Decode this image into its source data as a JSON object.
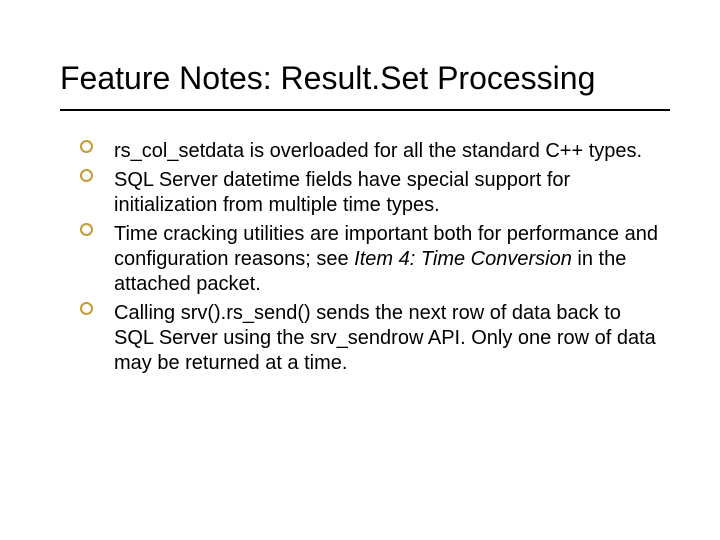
{
  "slide": {
    "title": "Feature Notes: Result.Set Processing",
    "bullets": [
      {
        "text_parts": [
          {
            "text": "rs_col_setdata is overloaded for all the standard C++ types.",
            "italic": false
          }
        ]
      },
      {
        "text_parts": [
          {
            "text": "SQL Server datetime fields have special support for initialization from multiple time types.",
            "italic": false
          }
        ]
      },
      {
        "text_parts": [
          {
            "text": "Time cracking utilities are important both for performance and configuration reasons; see ",
            "italic": false
          },
          {
            "text": "Item 4: Time Conversion",
            "italic": true
          },
          {
            "text": " in the attached packet.",
            "italic": false
          }
        ]
      },
      {
        "text_parts": [
          {
            "text": "Calling srv().rs_send() sends the next row of data back to SQL Server using the srv_sendrow API. Only one row of data may be returned at a time.",
            "italic": false
          }
        ]
      }
    ]
  },
  "style": {
    "bullet_ring_color": "#c49a3a"
  }
}
